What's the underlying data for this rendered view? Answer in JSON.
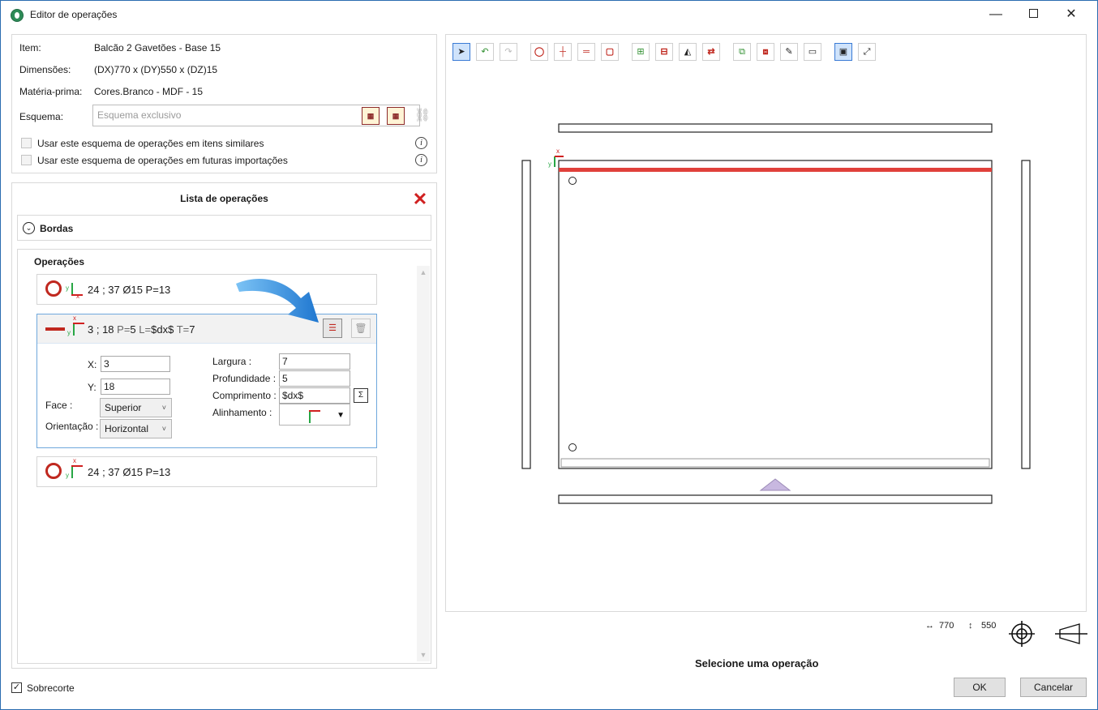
{
  "window": {
    "title": "Editor de operações",
    "minimize": "—",
    "close": "✕"
  },
  "info": {
    "item_label": "Item:",
    "item_value": "Balcão 2 Gavetões - Base 15",
    "dims_label": "Dimensões:",
    "dims_value": "(DX)770 x (DY)550 x (DZ)15",
    "material_label": "Matéria-prima:",
    "material_value": "Cores.Branco - MDF - 15",
    "scheme_label": "Esquema:",
    "scheme_placeholder": "Esquema exclusivo",
    "check_similar": "Usar este esquema de operações em itens similares",
    "check_future": "Usar este esquema de operações em futuras importações",
    "info_glyph": "i"
  },
  "ops": {
    "title": "Lista de operações",
    "bordas_label": "Bordas",
    "operations_label": "Operações",
    "items": [
      {
        "text": "24 ; 37 Ø15 P=13"
      },
      {
        "coords": "3 ; 18",
        "p_label": "P=",
        "p_value": "5",
        "l_label": "L=",
        "l_value": "$dx$",
        "t_label": "T=",
        "t_value": "7",
        "fields": {
          "x_label": "X:",
          "x_value": "3",
          "y_label": "Y:",
          "y_value": "18",
          "face_label": "Face :",
          "face_value": "Superior",
          "orient_label": "Orientação :",
          "orient_value": "Horizontal",
          "width_label": "Largura :",
          "width_value": "7",
          "depth_label": "Profundidade :",
          "depth_value": "5",
          "length_label": "Comprimento :",
          "length_value": "$dx$",
          "align_label": "Alinhamento :"
        }
      },
      {
        "text": "24 ; 37 Ø15 P=13"
      }
    ]
  },
  "toolbar": {
    "icons": [
      "select-icon",
      "undo-icon",
      "redo-icon",
      "hole-icon",
      "vertical-line-icon",
      "horizontal-line-icon",
      "rect-pocket-icon",
      "grid-add-icon",
      "grid-remove-icon",
      "mirror-icon",
      "swap-icon",
      "frame-add-icon",
      "frame-remove-icon",
      "ruler-icon",
      "border-icon",
      "fit-icon",
      "expand-icon"
    ]
  },
  "canvas": {
    "dx": "770",
    "dy": "550",
    "dx_glyph": "↔",
    "dy_glyph": "↕",
    "axis_x": "x",
    "axis_y": "y"
  },
  "status": {
    "message": "Selecione uma operação"
  },
  "footer": {
    "overcut_label": "Sobrecorte",
    "overcut_checked": true,
    "ok_label": "OK",
    "cancel_label": "Cancelar"
  },
  "colors": {
    "accent": "#3a7bd5",
    "operation_red": "#c0281f",
    "axis_green": "#28a745",
    "arrow_blue": "#2d8be0"
  }
}
